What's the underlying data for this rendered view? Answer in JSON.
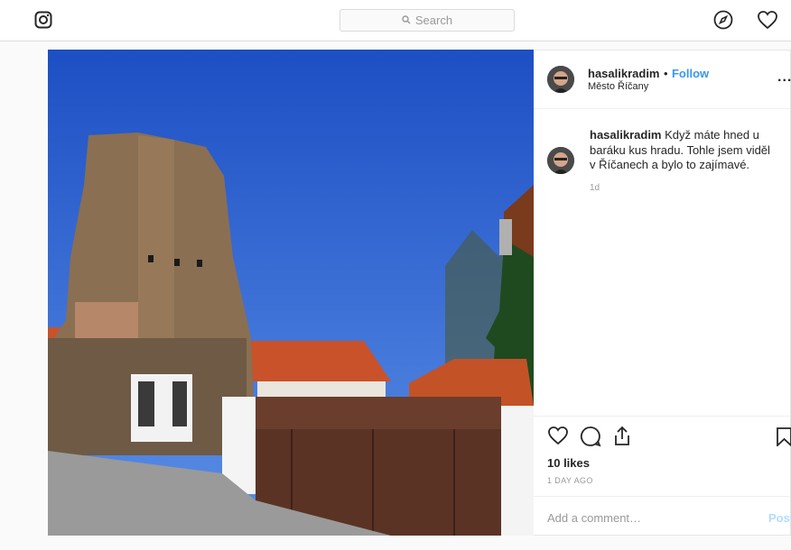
{
  "header": {
    "logo_icon": "instagram-icon",
    "search_placeholder": "Search",
    "explore_icon": "compass-icon",
    "activity_icon": "heart-icon"
  },
  "post": {
    "username": "hasalikradim",
    "separator": "•",
    "follow_label": "Follow",
    "location": "Město Říčany",
    "more_label": "...",
    "caption_username": "hasalikradim",
    "caption_text": "Když máte hned u baráku kus hradu. Tohle jsem viděl v Říčanech a bylo to zajímavé.",
    "relative_time": "1d",
    "likes": "10 likes",
    "date": "1 DAY AGO",
    "comment_placeholder": "Add a comment…",
    "post_label": "Post"
  },
  "colors": {
    "accent": "#3897f0",
    "sky": "#1f55c9",
    "roof": "#c8532b"
  }
}
